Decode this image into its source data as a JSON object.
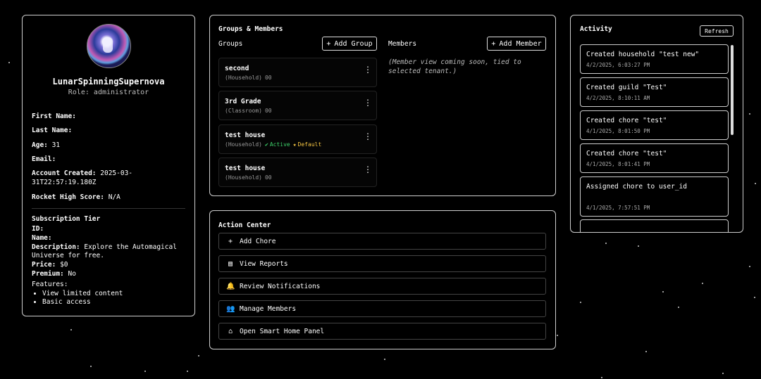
{
  "profile": {
    "username": "LunarSpinningSupernova",
    "role": "Role: administrator",
    "first_name_label": "First Name:",
    "first_name": "",
    "last_name_label": "Last Name:",
    "last_name": "",
    "age_label": "Age:",
    "age": "31",
    "email_label": "Email:",
    "email": "",
    "account_created_label": "Account Created:",
    "account_created": "2025-03-31T22:57:19.180Z",
    "high_score_label": "Rocket High Score:",
    "high_score": "N/A"
  },
  "subscription": {
    "title": "Subscription Tier",
    "id_label": "ID:",
    "name_label": "Name:",
    "description_label": "Description:",
    "description": "Explore the Automagical Universe for free.",
    "price_label": "Price:",
    "price": "$0",
    "premium_label": "Premium:",
    "premium": "No",
    "features_label": "Features:",
    "features": [
      "View limited content",
      "Basic access"
    ]
  },
  "groups_panel": {
    "title": "Groups & Members",
    "groups_label": "Groups",
    "add_group": "Add Group",
    "members_label": "Members",
    "add_member": "Add Member",
    "member_note": "(Member view coming soon, tied to selected tenant.)",
    "groups": [
      {
        "name": "second",
        "type": "(Household)",
        "code": "00"
      },
      {
        "name": "3rd Grade",
        "type": "(Classroom)",
        "code": "00"
      },
      {
        "name": "test house",
        "type": "(Household)",
        "active": "Active",
        "default": "Default"
      },
      {
        "name": "test house",
        "type": "(Household)",
        "code": "00"
      }
    ]
  },
  "action_center": {
    "title": "Action Center",
    "actions": [
      {
        "label": "Add Chore",
        "icon": "plus-icon"
      },
      {
        "label": "View Reports",
        "icon": "document-icon"
      },
      {
        "label": "Review Notifications",
        "icon": "bell-icon"
      },
      {
        "label": "Manage Members",
        "icon": "users-icon"
      },
      {
        "label": "Open Smart Home Panel",
        "icon": "home-icon"
      }
    ]
  },
  "activity": {
    "title": "Activity",
    "refresh": "Refresh",
    "items": [
      {
        "text": "Created household \"test new\"",
        "time": "4/2/2025, 6:03:27 PM"
      },
      {
        "text": "Created guild \"Test\"",
        "time": "4/2/2025, 8:10:11 AM"
      },
      {
        "text": "Created chore \"test\"",
        "time": "4/1/2025, 8:01:50 PM"
      },
      {
        "text": "Created chore \"test\"",
        "time": "4/1/2025, 8:01:41 PM"
      },
      {
        "text": "Assigned chore to user_id",
        "time": "4/1/2025, 7:57:51 PM"
      }
    ]
  },
  "colors": {
    "background": "#000000",
    "active": "#3ed36b",
    "default": "#f5c542",
    "border": "#cfcfcf"
  }
}
